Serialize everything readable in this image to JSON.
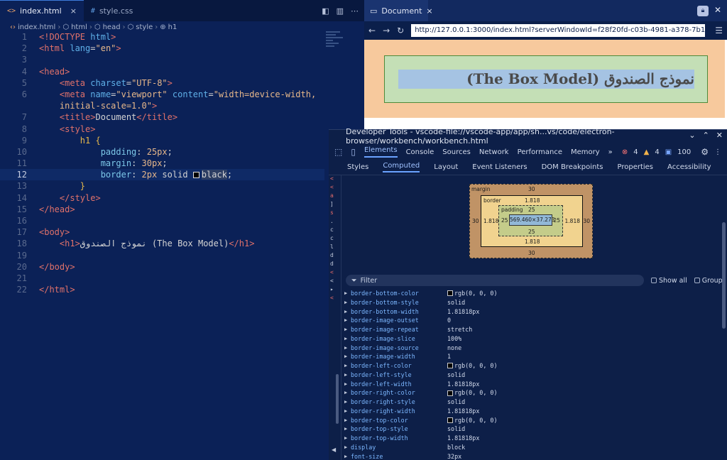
{
  "editor": {
    "tabs": [
      {
        "icon": "<>",
        "name": "index.html",
        "close": "×"
      },
      {
        "icon": "#",
        "name": "style.css"
      }
    ],
    "breadcrumb": [
      "index.html",
      "html",
      "head",
      "style",
      "h1"
    ],
    "lines": [
      {
        "n": "1",
        "tokens": [
          [
            "kw",
            "<!DOCTYPE "
          ],
          [
            "at",
            "html"
          ],
          [
            "kw",
            ">"
          ]
        ]
      },
      {
        "n": "2",
        "tokens": [
          [
            "kw",
            "<html "
          ],
          [
            "at",
            "lang"
          ],
          [
            "pun",
            "="
          ],
          [
            "str",
            "\"en\""
          ],
          [
            "kw",
            ">"
          ]
        ]
      },
      {
        "n": "3",
        "tokens": []
      },
      {
        "n": "4",
        "tokens": [
          [
            "kw",
            "<head>"
          ]
        ]
      },
      {
        "n": "5",
        "tokens": [
          [
            "txt",
            "    "
          ],
          [
            "kw",
            "<meta "
          ],
          [
            "at",
            "charset"
          ],
          [
            "pun",
            "="
          ],
          [
            "str",
            "\"UTF-8\""
          ],
          [
            "kw",
            ">"
          ]
        ]
      },
      {
        "n": "6",
        "tokens": [
          [
            "txt",
            "    "
          ],
          [
            "kw",
            "<meta "
          ],
          [
            "at",
            "name"
          ],
          [
            "pun",
            "="
          ],
          [
            "str",
            "\"viewport\""
          ],
          [
            "txt",
            " "
          ],
          [
            "at",
            "content"
          ],
          [
            "pun",
            "="
          ],
          [
            "str",
            "\"width=device-width,"
          ]
        ]
      },
      {
        "n": "",
        "tokens": [
          [
            "txt",
            "    "
          ],
          [
            "str",
            "initial-scale=1.0\""
          ],
          [
            "kw",
            ">"
          ]
        ]
      },
      {
        "n": "7",
        "tokens": [
          [
            "txt",
            "    "
          ],
          [
            "kw",
            "<title>"
          ],
          [
            "txt",
            "Document"
          ],
          [
            "kw",
            "</title>"
          ]
        ]
      },
      {
        "n": "8",
        "tokens": [
          [
            "txt",
            "    "
          ],
          [
            "kw",
            "<style>"
          ]
        ]
      },
      {
        "n": "9",
        "tokens": [
          [
            "txt",
            "        "
          ],
          [
            "sel",
            "h1"
          ],
          [
            "txt",
            " "
          ],
          [
            "br",
            "{"
          ]
        ]
      },
      {
        "n": "10",
        "tokens": [
          [
            "txt",
            "            "
          ],
          [
            "prop",
            "padding"
          ],
          [
            "pun",
            ": "
          ],
          [
            "num",
            "25px"
          ],
          [
            "pun",
            ";"
          ]
        ]
      },
      {
        "n": "11",
        "tokens": [
          [
            "txt",
            "            "
          ],
          [
            "prop",
            "margin"
          ],
          [
            "pun",
            ": "
          ],
          [
            "num",
            "30px"
          ],
          [
            "pun",
            ";"
          ]
        ]
      },
      {
        "n": "12",
        "current": true,
        "tokens": [
          [
            "txt",
            "            "
          ],
          [
            "prop",
            "border"
          ],
          [
            "pun",
            ": "
          ],
          [
            "num",
            "2px"
          ],
          [
            "txt",
            " solid "
          ],
          [
            "swatch",
            ""
          ],
          [
            "hl",
            "black"
          ],
          [
            "pun",
            ";"
          ]
        ]
      },
      {
        "n": "13",
        "tokens": [
          [
            "txt",
            "        "
          ],
          [
            "br",
            "}"
          ]
        ]
      },
      {
        "n": "14",
        "tokens": [
          [
            "txt",
            "    "
          ],
          [
            "kw",
            "</style>"
          ]
        ]
      },
      {
        "n": "15",
        "tokens": [
          [
            "kw",
            "</head>"
          ]
        ]
      },
      {
        "n": "16",
        "tokens": []
      },
      {
        "n": "17",
        "tokens": [
          [
            "kw",
            "<body>"
          ]
        ]
      },
      {
        "n": "18",
        "tokens": [
          [
            "txt",
            "    "
          ],
          [
            "kw",
            "<h1>"
          ],
          [
            "txt",
            "نموذج الصندوق (The Box Model)"
          ],
          [
            "kw",
            "</h1>"
          ]
        ]
      },
      {
        "n": "19",
        "tokens": []
      },
      {
        "n": "20",
        "tokens": [
          [
            "kw",
            "</body>"
          ]
        ]
      },
      {
        "n": "21",
        "tokens": []
      },
      {
        "n": "22",
        "tokens": [
          [
            "kw",
            "</html>"
          ]
        ]
      }
    ]
  },
  "browser": {
    "tab_title": "Document",
    "tab_close": "×",
    "url": "http://127.0.0.1:3000/index.html?serverWindowId=f28f20fd-c03b-4981-a378-7b1a98facad8",
    "heading": "نموذج الصندوق (The Box Model)",
    "colors": {
      "margin": "#f7c99d",
      "border": "#4e8a3a",
      "padding": "#c4dfb6",
      "content": "#a5c3e3"
    }
  },
  "devtools": {
    "title": "Developer Tools - vscode-file://vscode-app/app/sh...vs/code/electron-browser/workbench/workbench.html",
    "tabs": [
      "Elements",
      "Console",
      "Sources",
      "Network",
      "Performance",
      "Memory"
    ],
    "more": "»",
    "badges": {
      "errors": "4",
      "warnings": "4",
      "info": "100"
    },
    "subtabs": [
      "Styles",
      "Computed",
      "Layout",
      "Event Listeners",
      "DOM Breakpoints",
      "Properties",
      "Accessibility"
    ],
    "boxmodel": {
      "margin_label": "margin",
      "margin": {
        "top": "30",
        "right": "30",
        "bottom": "30",
        "left": "30"
      },
      "border_label": "border",
      "border": {
        "top": "1.818",
        "right": "1.818",
        "bottom": "1.818",
        "left": "1.818"
      },
      "padding_label": "padding",
      "padding": {
        "top": "25",
        "right": "25",
        "bottom": "25",
        "left": "25"
      },
      "content": "569.460×37.273"
    },
    "filter_placeholder": "Filter",
    "show_all": "Show all",
    "group": "Group",
    "properties": [
      {
        "name": "border-bottom-color",
        "value": "rgb(0, 0, 0)",
        "swatch": true
      },
      {
        "name": "border-bottom-style",
        "value": "solid"
      },
      {
        "name": "border-bottom-width",
        "value": "1.81818px"
      },
      {
        "name": "border-image-outset",
        "value": "0"
      },
      {
        "name": "border-image-repeat",
        "value": "stretch"
      },
      {
        "name": "border-image-slice",
        "value": "100%"
      },
      {
        "name": "border-image-source",
        "value": "none"
      },
      {
        "name": "border-image-width",
        "value": "1"
      },
      {
        "name": "border-left-color",
        "value": "rgb(0, 0, 0)",
        "swatch": true
      },
      {
        "name": "border-left-style",
        "value": "solid"
      },
      {
        "name": "border-left-width",
        "value": "1.81818px"
      },
      {
        "name": "border-right-color",
        "value": "rgb(0, 0, 0)",
        "swatch": true
      },
      {
        "name": "border-right-style",
        "value": "solid"
      },
      {
        "name": "border-right-width",
        "value": "1.81818px"
      },
      {
        "name": "border-top-color",
        "value": "rgb(0, 0, 0)",
        "swatch": true
      },
      {
        "name": "border-top-style",
        "value": "solid"
      },
      {
        "name": "border-top-width",
        "value": "1.81818px"
      },
      {
        "name": "display",
        "value": "block"
      },
      {
        "name": "font-size",
        "value": "32px"
      }
    ]
  }
}
